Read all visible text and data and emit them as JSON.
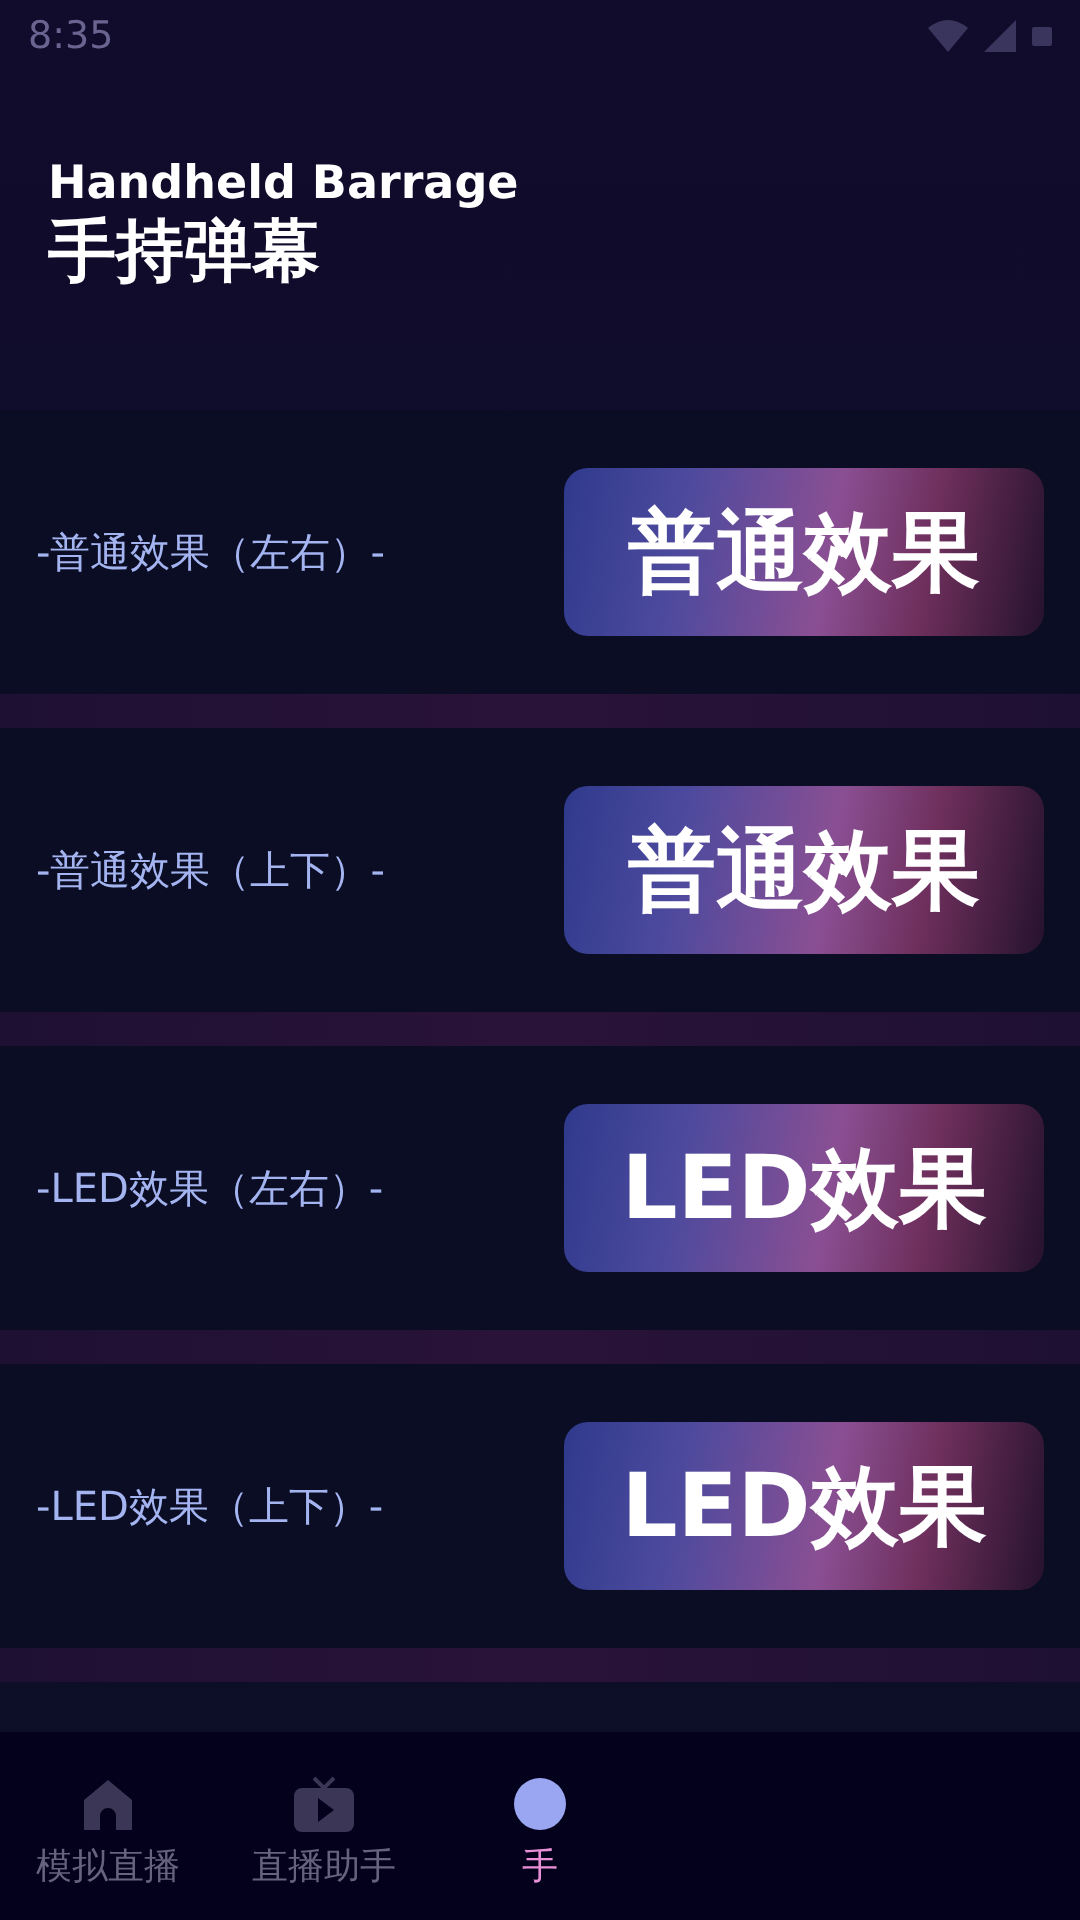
{
  "status_bar": {
    "time": "8:35"
  },
  "header": {
    "subtitle": "Handheld Barrage",
    "title": "手持弹幕"
  },
  "effects": [
    {
      "label": "-普通效果（左右）-",
      "button": "普通效果"
    },
    {
      "label": "-普通效果（上下）-",
      "button": "普通效果"
    },
    {
      "label": "-LED效果（左右）-",
      "button": "LED效果"
    },
    {
      "label": "-LED效果（上下）-",
      "button": "LED效果"
    }
  ],
  "nav": [
    {
      "label": "模拟直播",
      "kind": "home",
      "selected": false
    },
    {
      "label": "直播助手",
      "kind": "tv",
      "selected": false
    },
    {
      "label": "手",
      "kind": "circle",
      "selected": true
    }
  ]
}
